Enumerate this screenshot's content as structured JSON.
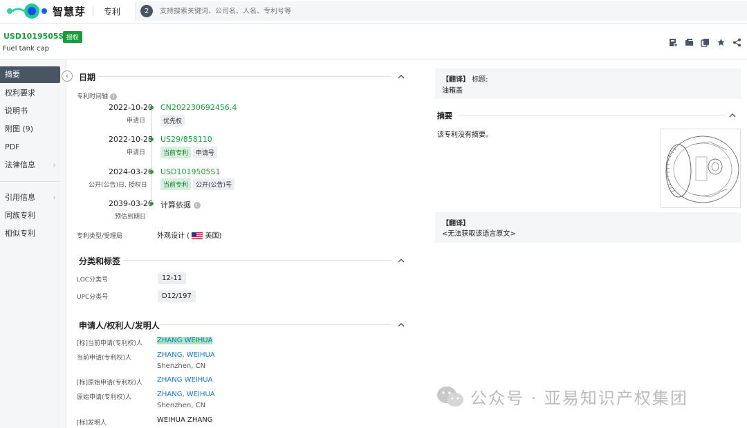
{
  "app": {
    "brand": "智慧芽",
    "nav": "专利",
    "search_badge": "2",
    "search_placeholder": "支持搜索关键词、公司名、人名、专利号等"
  },
  "patent": {
    "number": "USD1019505S1",
    "status": "授权",
    "title": "Fuel tank cap"
  },
  "toolbar": {
    "icons": [
      "add-to-workspace-icon",
      "folder-icon",
      "copy-icon",
      "star-icon",
      "share-icon"
    ]
  },
  "sidebar": {
    "items": [
      {
        "label": "摘要",
        "active": true
      },
      {
        "label": "权利要求"
      },
      {
        "label": "说明书"
      },
      {
        "label": "附图 (9)"
      },
      {
        "label": "PDF"
      },
      {
        "label": "法律信息"
      },
      {
        "label": "引用信息"
      },
      {
        "label": "同族专利"
      },
      {
        "label": "相似专利"
      }
    ]
  },
  "dates": {
    "section_title": "日期",
    "timeline_label": "专利时间轴",
    "events": [
      {
        "date": "2022-10-20",
        "label": "申请日",
        "number": "CN202230692456.4",
        "tags": [
          "优先权"
        ]
      },
      {
        "date": "2022-10-28",
        "label": "申请日",
        "number": "US29/858110",
        "tags": [
          "当前专利",
          "申请号"
        ]
      },
      {
        "date": "2024-03-26",
        "label": "公开(公告)日, 授权日",
        "number": "USD1019505S1",
        "tags": [
          "当前专利",
          "公开(公告)号"
        ]
      },
      {
        "date": "2039-03-26",
        "label": "预估到期日",
        "number": "计算依据"
      }
    ],
    "type_label": "专利类型/受理局",
    "type_value": "外观设计 (",
    "country": "美国)"
  },
  "classification": {
    "section_title": "分类和标签",
    "loc_label": "LOC分类号",
    "loc_value": "12-11",
    "upc_label": "UPC分类号",
    "upc_value": "D12/197"
  },
  "applicants": {
    "section_title": "申请人/权利人/发明人",
    "rows": [
      {
        "label": "[标]当前申请(专利权)人",
        "value": "ZHANG WEIHUA"
      },
      {
        "label": "当前申请(专利权)人",
        "value": "ZHANG, WEIHUA",
        "location": "Shenzhen, CN"
      },
      {
        "label": "[标]原始申请(专利权)人",
        "value": "ZHANG WEIHUA"
      },
      {
        "label": "原始申请(专利权)人",
        "value": "ZHANG, WEIHUA",
        "location": "Shenzhen, CN"
      },
      {
        "label": "[标]发明人",
        "value": "WEIHUA ZHANG"
      }
    ]
  },
  "right": {
    "translate_tag": "【翻译】",
    "title_label": "标题:",
    "title_cn": "油箱盖",
    "abstract_title": "摘要",
    "abstract_text": "该专利没有摘要。",
    "translate_tag2": "【翻译】",
    "no_source": "<无法获取该语言原文>"
  },
  "watermark": "公众号 · 亚易知识产权集团",
  "colors": {
    "brand_green": "#1a9c3c",
    "link_blue": "#1a73c8",
    "sidebar_active": "#4a5563"
  }
}
